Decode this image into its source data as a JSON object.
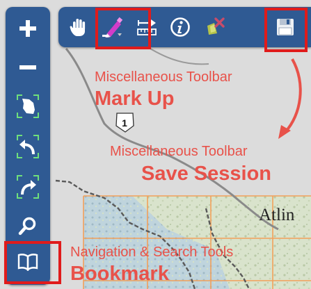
{
  "navigation_bar": {
    "buttons": [
      {
        "name": "zoom-in",
        "icon": "plus-icon"
      },
      {
        "name": "zoom-out",
        "icon": "minus-icon"
      },
      {
        "name": "full-extent",
        "icon": "province-extent-icon"
      },
      {
        "name": "previous-extent",
        "icon": "back-arrow-icon"
      },
      {
        "name": "next-extent",
        "icon": "forward-arrow-icon"
      },
      {
        "name": "search",
        "icon": "magnifier-icon"
      },
      {
        "name": "bookmark",
        "icon": "book-icon"
      }
    ]
  },
  "misc_toolbar": {
    "buttons": [
      {
        "name": "pan",
        "icon": "hand-icon"
      },
      {
        "name": "mark-up",
        "icon": "pencil-icon"
      },
      {
        "name": "measure",
        "icon": "measure-icon"
      },
      {
        "name": "identify",
        "icon": "info-icon"
      },
      {
        "name": "clear",
        "icon": "clear-icon"
      },
      {
        "name": "save-session",
        "icon": "floppy-disk-icon"
      }
    ]
  },
  "annotations": {
    "markup_group": "Miscellaneous Toolbar",
    "markup_tool": "Mark Up",
    "save_group": "Miscellaneous Toolbar",
    "save_tool": "Save Session",
    "bookmark_group": "Navigation & Search Tools",
    "bookmark_tool": "Bookmark"
  },
  "map": {
    "highway_shield": "1",
    "place_label": "Atlin"
  },
  "colors": {
    "toolbar": "#2f5a93",
    "highlight": "#e01b1b",
    "annotation": "#e8524a",
    "grid": "#f2a05a",
    "highway": "#8a8a8a"
  }
}
